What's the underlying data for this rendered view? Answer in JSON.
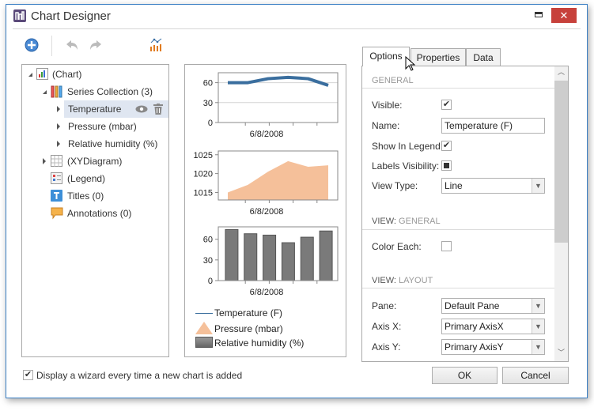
{
  "window": {
    "title": "Chart Designer"
  },
  "toolbar": {
    "add": "add-icon",
    "undo": "undo-icon",
    "redo": "redo-icon",
    "wizard": "chart-wizard-icon"
  },
  "tree": {
    "chart": "(Chart)",
    "series_collection": "Series Collection (3)",
    "series": [
      "Temperature",
      "Pressure (mbar)",
      "Relative humidity (%)"
    ],
    "diagram": "(XYDiagram)",
    "legend": "(Legend)",
    "titles": "Titles (0)",
    "annotations": "Annotations (0)"
  },
  "preview": {
    "legend": [
      "Temperature (F)",
      "Pressure (mbar)",
      "Relative humidity (%)"
    ],
    "colors": {
      "temperature": "#3a6e9e",
      "pressure": "#f5c09a",
      "humidity": "#7a7a7a"
    }
  },
  "chart_data": [
    {
      "type": "line",
      "series": [
        {
          "name": "Temperature (F)",
          "values": [
            60,
            60,
            66,
            68,
            66,
            56
          ]
        }
      ],
      "xlabel": "6/8/2008",
      "yticks": [
        "0",
        "30",
        "60"
      ],
      "ylim": [
        0,
        75
      ],
      "grid": true
    },
    {
      "type": "area",
      "series": [
        {
          "name": "Pressure (mbar)",
          "values": [
            1015,
            1017,
            1020.5,
            1023.3,
            1021.8,
            1022.2
          ]
        }
      ],
      "xlabel": "6/8/2008",
      "yticks": [
        "1015",
        "1020",
        "1025"
      ],
      "ylim": [
        1013,
        1026
      ]
    },
    {
      "type": "bar",
      "series": [
        {
          "name": "Relative humidity (%)",
          "values": [
            74,
            68,
            66,
            55,
            63,
            72
          ]
        }
      ],
      "xlabel": "6/8/2008",
      "yticks": [
        "0",
        "30",
        "60"
      ],
      "ylim": [
        0,
        78
      ]
    }
  ],
  "tabs": [
    "Options",
    "Properties",
    "Data"
  ],
  "active_tab": "Options",
  "options": {
    "general_header": "GENERAL",
    "visible_label": "Visible:",
    "visible": true,
    "name_label": "Name:",
    "name_value": "Temperature (F)",
    "show_legend_label": "Show In Legend:",
    "show_legend": true,
    "labels_visibility_label": "Labels Visibility:",
    "labels_visibility": "indeterminate",
    "view_type_label": "View Type:",
    "view_type": "Line",
    "view_prefix": "VIEW:",
    "view_general_header": "GENERAL",
    "color_each_label": "Color Each:",
    "color_each": false,
    "view_layout_header": "LAYOUT",
    "pane_label": "Pane:",
    "pane": "Default Pane",
    "axis_x_label": "Axis X:",
    "axis_x": "Primary AxisX",
    "axis_y_label": "Axis Y:",
    "axis_y": "Primary AxisY"
  },
  "footer": {
    "wizard_checkbox": "Display a wizard every time a new chart is added",
    "wizard_checked": true,
    "ok": "OK",
    "cancel": "Cancel"
  }
}
